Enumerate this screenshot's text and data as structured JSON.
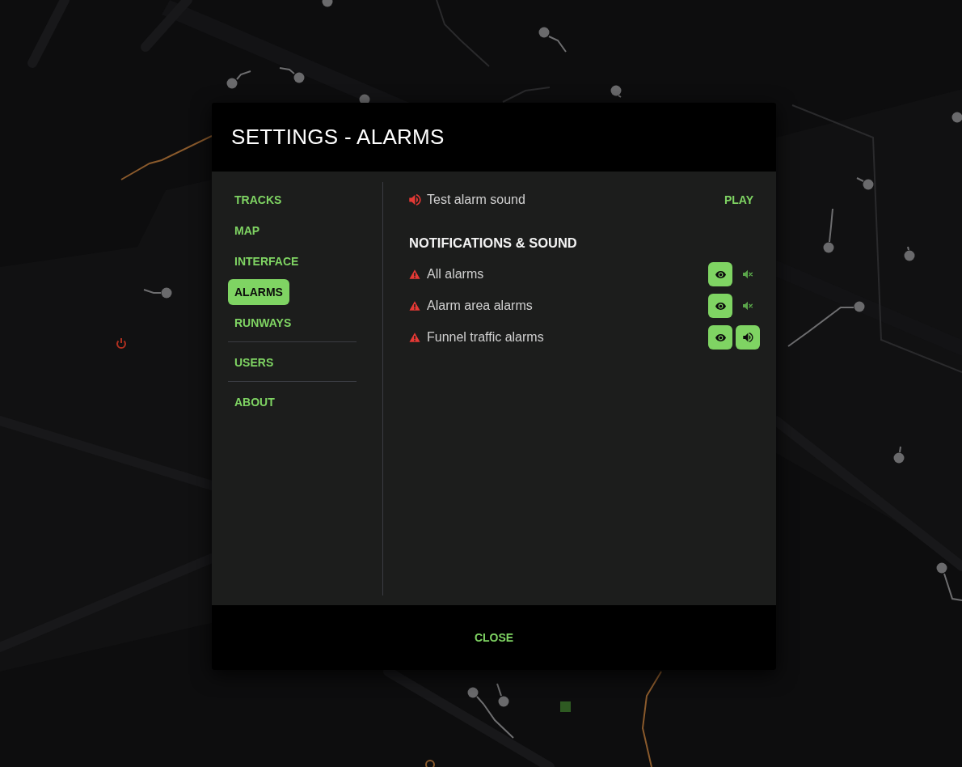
{
  "dialog": {
    "title": "SETTINGS - ALARMS"
  },
  "sidebar": {
    "groups": [
      {
        "items": [
          {
            "label": "TRACKS",
            "selected": false
          },
          {
            "label": "MAP",
            "selected": false
          },
          {
            "label": "INTERFACE",
            "selected": false
          },
          {
            "label": "ALARMS",
            "selected": true
          },
          {
            "label": "RUNWAYS",
            "selected": false
          }
        ]
      },
      {
        "items": [
          {
            "label": "USERS",
            "selected": false
          }
        ]
      },
      {
        "items": [
          {
            "label": "ABOUT",
            "selected": false
          }
        ]
      }
    ]
  },
  "test_sound": {
    "label": "Test alarm sound",
    "button": "PLAY"
  },
  "section_title": "NOTIFICATIONS & SOUND",
  "alarms": [
    {
      "label": "All alarms",
      "visible": true,
      "sound": false
    },
    {
      "label": "Alarm area alarms",
      "visible": true,
      "sound": false
    },
    {
      "label": "Funnel traffic alarms",
      "visible": true,
      "sound": true
    }
  ],
  "footer": {
    "button": "CLOSE"
  }
}
